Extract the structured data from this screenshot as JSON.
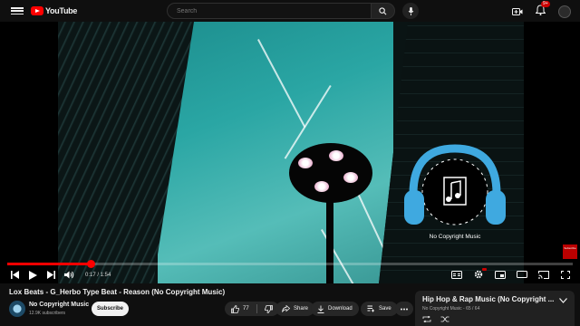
{
  "header": {
    "logo_text": "YouTube",
    "search_placeholder": "Search",
    "notification_count": "9+"
  },
  "player": {
    "watermark_caption": "No Copyright Music",
    "corner_badge": "Subscribe",
    "time_display": "0:17 / 1:54",
    "progress": 0.148,
    "volume_level": 1.0
  },
  "video": {
    "title": "Lox Beats - G_Herbo Type Beat - Reason (No Copyright Music)",
    "channel_name": "No Copyright Music",
    "channel_subs": "12.9K subscribers",
    "subscribe_label": "Subscribe",
    "like_count": "77",
    "share_label": "Share",
    "download_label": "Download",
    "save_label": "Save"
  },
  "playlist": {
    "title": "Hip Hop & Rap Music (No Copyright ...",
    "meta": "No Copyright Music - 65 / 64"
  },
  "colors": {
    "accent": "#ff0000",
    "background": "#0f0f0f",
    "sky": "#2aa6a4",
    "headphone": "#3fa9e0"
  }
}
